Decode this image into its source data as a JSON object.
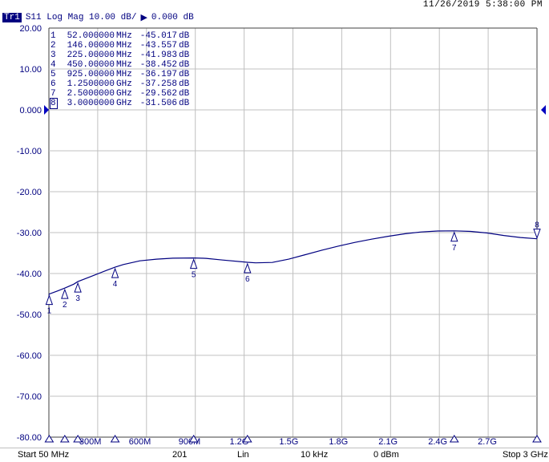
{
  "header": {
    "datetime": "11/26/2019 5:38:00 PM",
    "trace_badge": "Tr1",
    "trace_info": "S11 Log Mag 10.00 dB/",
    "ref_value": "0.000 dB"
  },
  "markers": [
    {
      "num": "1",
      "freq": "52.000000",
      "unit": "MHz",
      "value": "-45.017",
      "db": "dB"
    },
    {
      "num": "2",
      "freq": "146.00000",
      "unit": "MHz",
      "value": "-43.557",
      "db": "dB"
    },
    {
      "num": "3",
      "freq": "225.00000",
      "unit": "MHz",
      "value": "-41.983",
      "db": "dB"
    },
    {
      "num": "4",
      "freq": "450.00000",
      "unit": "MHz",
      "value": "-38.452",
      "db": "dB"
    },
    {
      "num": "5",
      "freq": "925.00000",
      "unit": "MHz",
      "value": "-36.197",
      "db": "dB"
    },
    {
      "num": "6",
      "freq": "1.2500000",
      "unit": "GHz",
      "value": "-37.258",
      "db": "dB"
    },
    {
      "num": "7",
      "freq": "2.5000000",
      "unit": "GHz",
      "value": "-29.562",
      "db": "dB"
    },
    {
      "num": "8",
      "freq": "3.0000000",
      "unit": "GHz",
      "value": "-31.506",
      "db": "dB"
    }
  ],
  "status": {
    "start": "Start 50 MHz",
    "points": "201",
    "sweep": "Lin",
    "ifbw": "10 kHz",
    "power": "0 dBm",
    "stop": "Stop 3 GHz"
  },
  "colors": {
    "trace": "#000080",
    "grid": "#c0c0c0",
    "axis": "#404040",
    "ref_marker": "#0000c0"
  },
  "chart_data": {
    "type": "line",
    "xlim": [
      50,
      3000
    ],
    "ylim": [
      -80,
      20
    ],
    "ytick_values": [
      20,
      10,
      0,
      -10,
      -20,
      -30,
      -40,
      -50,
      -60,
      -70,
      -80
    ],
    "ytick_labels": [
      "20.00",
      "10.00",
      "0.000",
      "-10.00",
      "-20.00",
      "-30.00",
      "-40.00",
      "-50.00",
      "-60.00",
      "-70.00",
      "-80.00"
    ],
    "xtick_values": [
      300,
      600,
      900,
      1200,
      1500,
      1800,
      2100,
      2400,
      2700
    ],
    "xtick_labels": [
      "300M",
      "600M",
      "900M",
      "1.2G",
      "1.5G",
      "1.8G",
      "2.1G",
      "2.4G",
      "2.7G"
    ],
    "grid": true,
    "reference_level": 0,
    "series": [
      {
        "x": [
          50,
          52,
          100,
          146,
          200,
          225,
          300,
          400,
          450,
          500,
          600,
          700,
          800,
          925,
          1000,
          1100,
          1250,
          1300,
          1400,
          1500,
          1600,
          1700,
          1800,
          1900,
          2000,
          2100,
          2200,
          2300,
          2400,
          2500,
          2600,
          2700,
          2800,
          2900,
          3000
        ],
        "y": [
          -45.2,
          -45.02,
          -44.3,
          -43.56,
          -42.6,
          -41.98,
          -40.8,
          -39.2,
          -38.45,
          -37.8,
          -36.9,
          -36.5,
          -36.25,
          -36.2,
          -36.3,
          -36.7,
          -37.26,
          -37.4,
          -37.3,
          -36.5,
          -35.4,
          -34.3,
          -33.3,
          -32.4,
          -31.6,
          -30.9,
          -30.3,
          -29.85,
          -29.6,
          -29.56,
          -29.7,
          -30.1,
          -30.7,
          -31.2,
          -31.51
        ]
      }
    ],
    "marker_positions": [
      {
        "label": "1",
        "x": 52,
        "y": -45.017
      },
      {
        "label": "2",
        "x": 146,
        "y": -43.557
      },
      {
        "label": "3",
        "x": 225,
        "y": -41.983
      },
      {
        "label": "4",
        "x": 450,
        "y": -38.452
      },
      {
        "label": "5",
        "x": 925,
        "y": -36.197
      },
      {
        "label": "6",
        "x": 1250,
        "y": -37.258
      },
      {
        "label": "7",
        "x": 2500,
        "y": -29.562
      },
      {
        "label": "8",
        "x": 3000,
        "y": -31.506
      }
    ]
  }
}
